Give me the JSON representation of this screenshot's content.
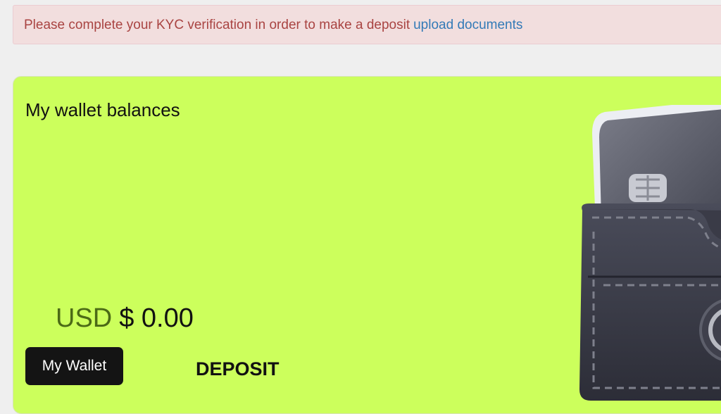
{
  "alert": {
    "message": "Please complete your KYC verification in order to make a deposit",
    "link_label": "upload documents"
  },
  "wallet_card": {
    "title": "My wallet balances",
    "currency": "USD",
    "amount": "$ 0.00",
    "my_wallet_button": "My Wallet",
    "deposit_button": "DEPOSIT",
    "illustration": "wallet-with-card-icon",
    "background_color": "#ccff5c"
  }
}
